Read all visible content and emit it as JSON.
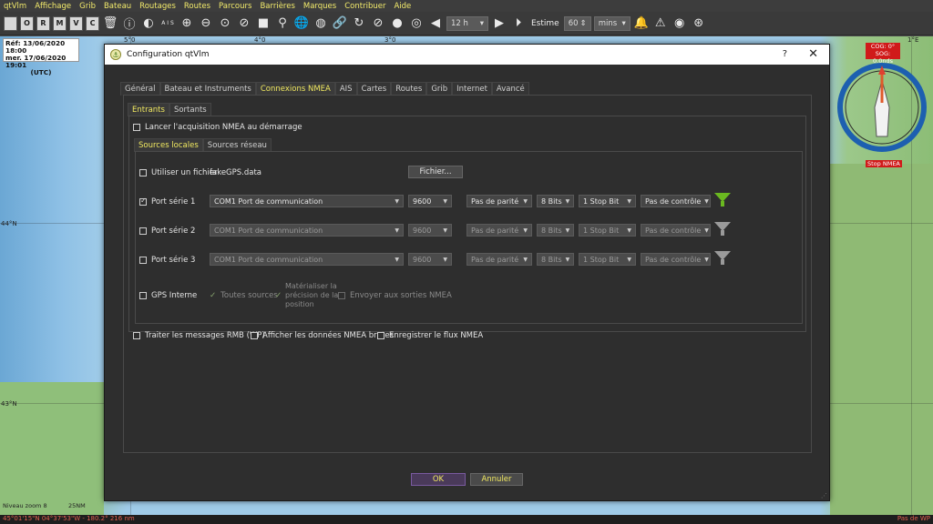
{
  "menu": [
    "qtVlm",
    "Affichage",
    "Grib",
    "Bateau",
    "Routages",
    "Routes",
    "Parcours",
    "Barrières",
    "Marques",
    "Contribuer",
    "Aide"
  ],
  "toolbar": {
    "square_icons": [
      "",
      "O",
      "R",
      "M",
      "V",
      "C"
    ],
    "ais_label": "A I S",
    "time_step": "12 h",
    "estime_label": "Estime",
    "estime_value": "60",
    "estime_unit": "mins"
  },
  "map": {
    "info_ref": "Réf: 13/06/2020 18:00",
    "info_date": "mer. 17/06/2020 19:01",
    "info_utc": "(UTC)",
    "lon_labels": [
      "5°0",
      "4°0",
      "3°0",
      "1°E"
    ],
    "lat_labels": [
      "44°N",
      "43°N"
    ],
    "cog": "COG: 0°",
    "sog": "SOG: 0.0nds",
    "stop_nmea": "Stop NMEA",
    "zoom_label": "Niveau zoom 8",
    "scale_label": "25NM",
    "status_left": "45°01'15\"N 04°37'53\"W - 180.2° 216 nm",
    "status_right": "Pas de WP"
  },
  "dialog": {
    "title": "Configuration qtVlm",
    "help": "?",
    "close": "✕",
    "main_tabs": [
      "Général",
      "Bateau et Instruments",
      "Connexions NMEA",
      "AIS",
      "Cartes",
      "Routes",
      "Grib",
      "Internet",
      "Avancé"
    ],
    "io_tabs": [
      "Entrants",
      "Sortants"
    ],
    "start_acq": "Lancer l'acquisition NMEA au démarrage",
    "source_tabs": [
      "Sources locales",
      "Sources réseau"
    ],
    "use_file": "Utiliser un fichier",
    "file_name": "fakeGPS.data",
    "file_button": "Fichier...",
    "ports": [
      {
        "label": "Port série 1",
        "port": "COM1 Port de communication",
        "baud": "9600",
        "parity": "Pas de parité",
        "bits": "8 Bits",
        "stop": "1 Stop Bit",
        "flow": "Pas de contrôle"
      },
      {
        "label": "Port série 2",
        "port": "COM1 Port de communication",
        "baud": "9600",
        "parity": "Pas de parité",
        "bits": "8 Bits",
        "stop": "1 Stop Bit",
        "flow": "Pas de contrôle"
      },
      {
        "label": "Port série 3",
        "port": "COM1 Port de communication",
        "baud": "9600",
        "parity": "Pas de parité",
        "bits": "8 Bits",
        "stop": "1 Stop Bit",
        "flow": "Pas de contrôle"
      }
    ],
    "gps_internal": "GPS Interne",
    "all_sources": "Toutes sources",
    "materialize_1": "Matérialiser la",
    "materialize_2": "précision de la",
    "materialize_3": "position",
    "send_outputs": "Envoyer aux sorties NMEA",
    "rmb": "Traiter les messages RMB (WP)",
    "raw": "Afficher les données NMEA brutes",
    "record": "Enregistrer le flux NMEA",
    "ok": "OK",
    "cancel": "Annuler"
  },
  "colors": {
    "menu_text": "#f2ea6b",
    "active_tab": "#f0e860",
    "funnel_active": "#6ab820",
    "funnel_inactive": "#9a9a9a",
    "alert_red": "#d01a1a"
  }
}
